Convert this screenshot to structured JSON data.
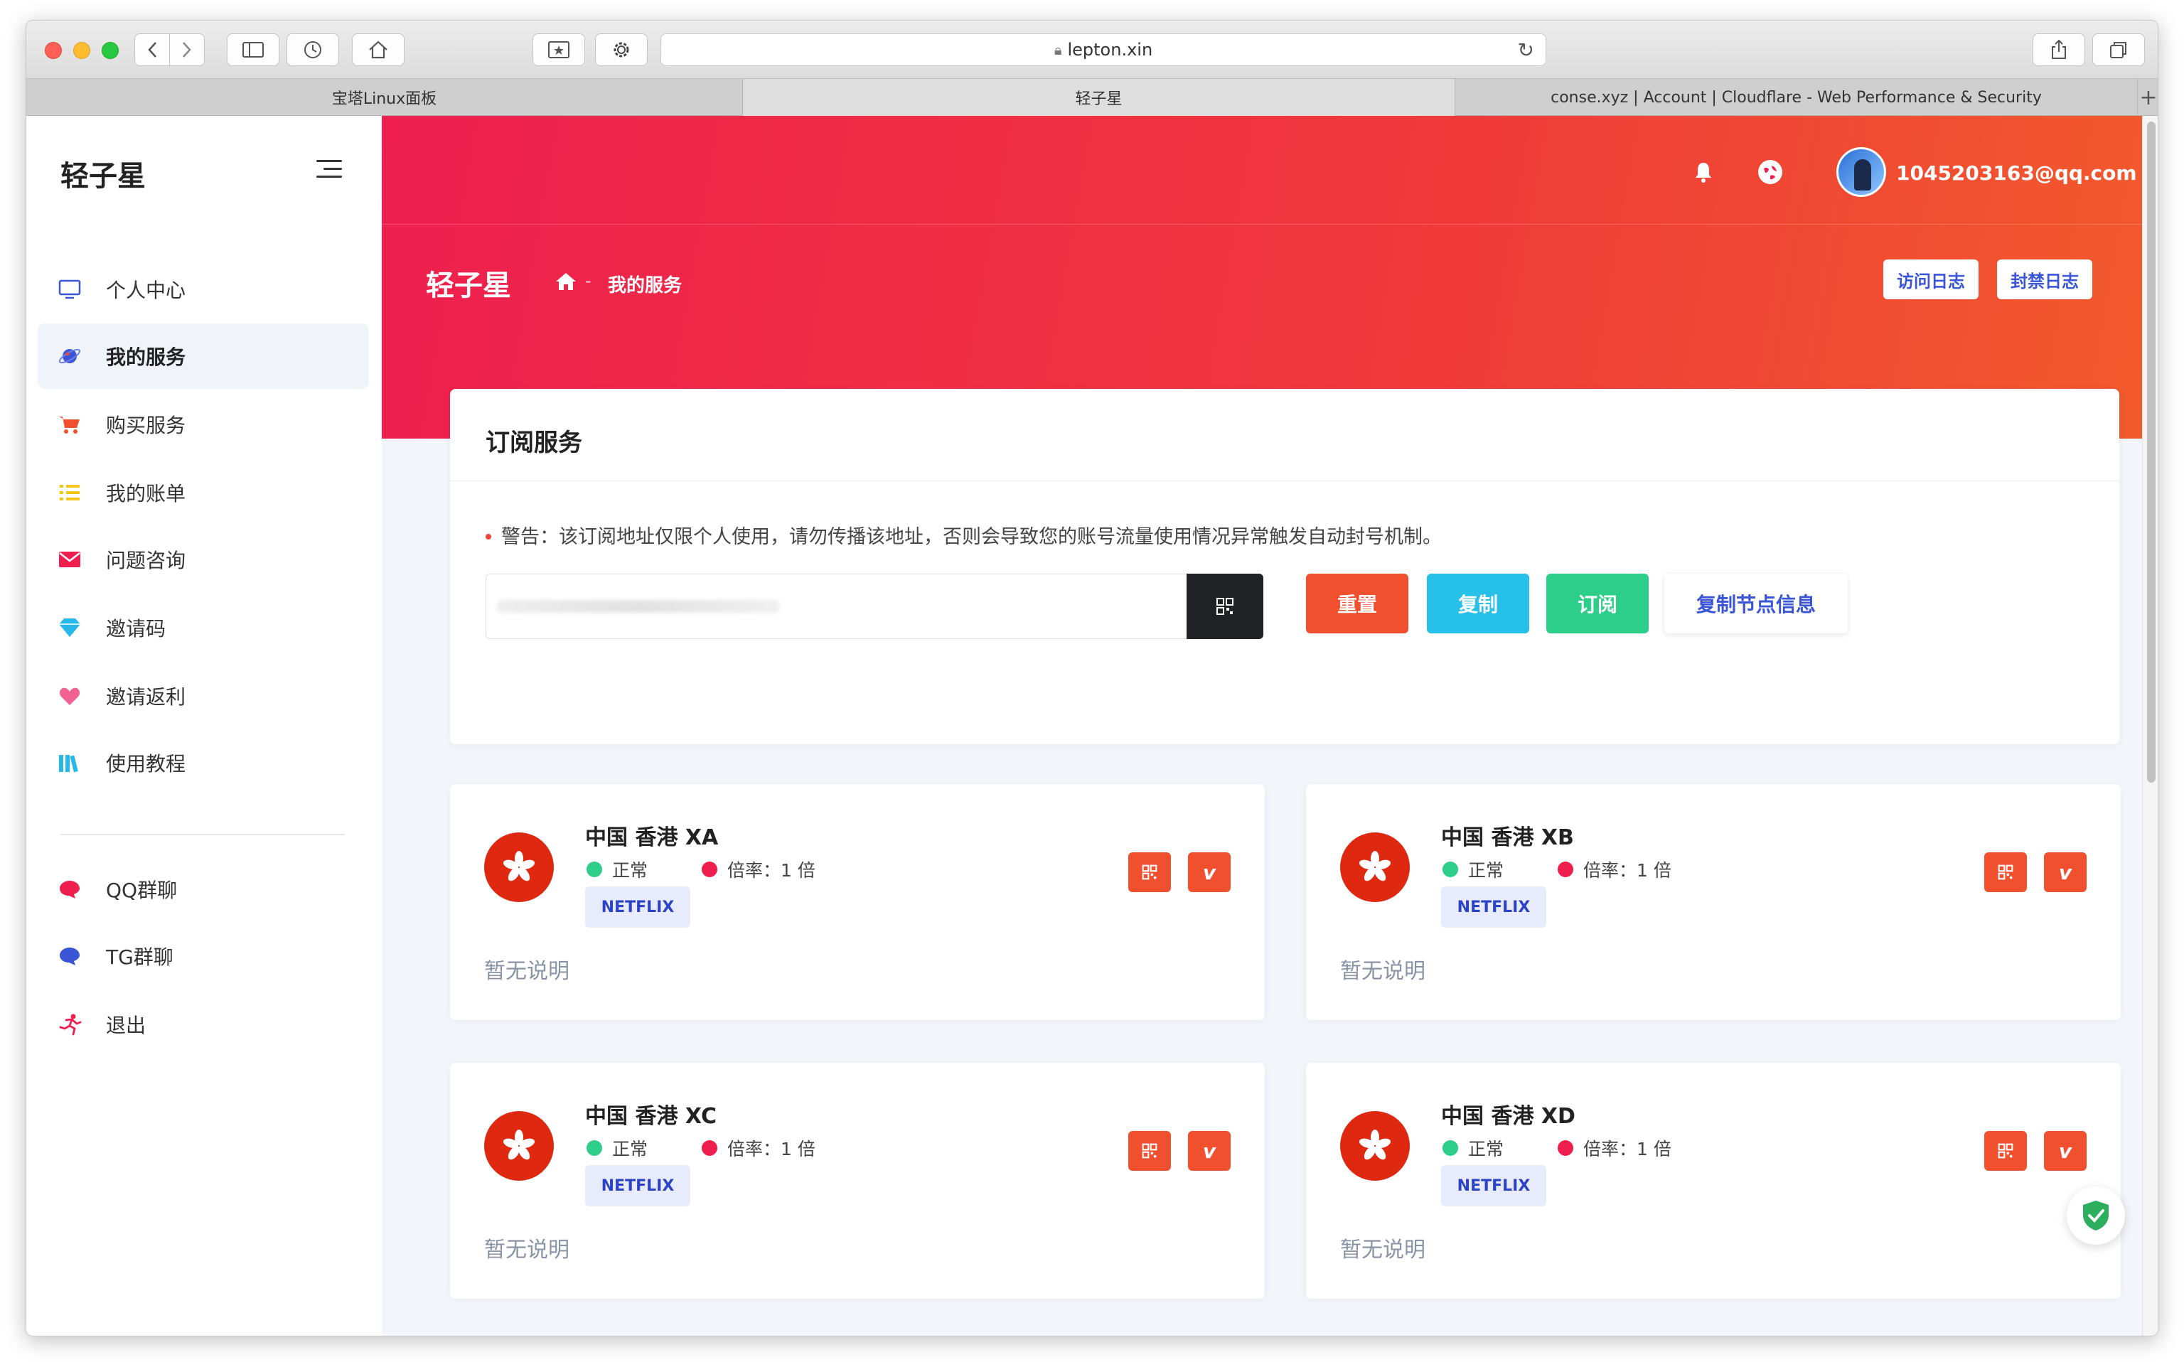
{
  "browser": {
    "address": "lepton.xin",
    "tabs": [
      {
        "label": "宝塔Linux面板"
      },
      {
        "label": "轻子星"
      },
      {
        "label": "conse.xyz | Account | Cloudflare - Web Performance & Security"
      }
    ],
    "active_tab": 1
  },
  "sidebar": {
    "brand": "轻子星",
    "items": [
      {
        "label": "个人中心",
        "icon": "monitor-icon",
        "color": "#3a55d6"
      },
      {
        "label": "我的服务",
        "icon": "planet-icon",
        "color": "#3a55d6",
        "active": true
      },
      {
        "label": "购买服务",
        "icon": "cart-icon",
        "color": "#f1502f"
      },
      {
        "label": "我的账单",
        "icon": "list-icon",
        "color": "#f5c518"
      },
      {
        "label": "问题咨询",
        "icon": "mail-icon",
        "color": "#ee1f4f"
      },
      {
        "label": "邀请码",
        "icon": "diamond-icon",
        "color": "#27b7e8"
      },
      {
        "label": "邀请返利",
        "icon": "heart-icon",
        "color": "#f06292"
      },
      {
        "label": "使用教程",
        "icon": "books-icon",
        "color": "#27b7e8"
      },
      {
        "label": "QQ群聊",
        "icon": "chat-red-icon",
        "color": "#ee1f4f"
      },
      {
        "label": "TG群聊",
        "icon": "chat-blue-icon",
        "color": "#3a55d6"
      },
      {
        "label": "退出",
        "icon": "run-icon",
        "color": "#ee1f4f"
      }
    ]
  },
  "header": {
    "user_email": "1045203163@qq.com",
    "page_title": "轻子星",
    "breadcrumb_current": "我的服务",
    "breadcrumb_sep": "-",
    "visit_log_label": "访问日志",
    "ban_log_label": "封禁日志"
  },
  "subscription": {
    "title": "订阅服务",
    "warning": "警告：该订阅地址仅限个人使用，请勿传播该地址，否则会导致您的账号流量使用情况异常触发自动封号机制。",
    "reset_label": "重置",
    "copy_label": "复制",
    "subscribe_label": "订阅",
    "copy_nodes_label": "复制节点信息",
    "colors": {
      "reset": "#f1502f",
      "copy": "#27c0e8",
      "subscribe": "#2dce89"
    }
  },
  "nodes": [
    {
      "name": "中国 香港 XA",
      "status": "正常",
      "rate": "倍率：1 倍",
      "tag": "NETFLIX",
      "desc": "暂无说明"
    },
    {
      "name": "中国 香港 XB",
      "status": "正常",
      "rate": "倍率：1 倍",
      "tag": "NETFLIX",
      "desc": "暂无说明"
    },
    {
      "name": "中国 香港 XC",
      "status": "正常",
      "rate": "倍率：1 倍",
      "tag": "NETFLIX",
      "desc": "暂无说明"
    },
    {
      "name": "中国 香港 XD",
      "status": "正常",
      "rate": "倍率：1 倍",
      "tag": "NETFLIX",
      "desc": "暂无说明"
    }
  ],
  "node_buttons": {
    "v_label": "v"
  }
}
